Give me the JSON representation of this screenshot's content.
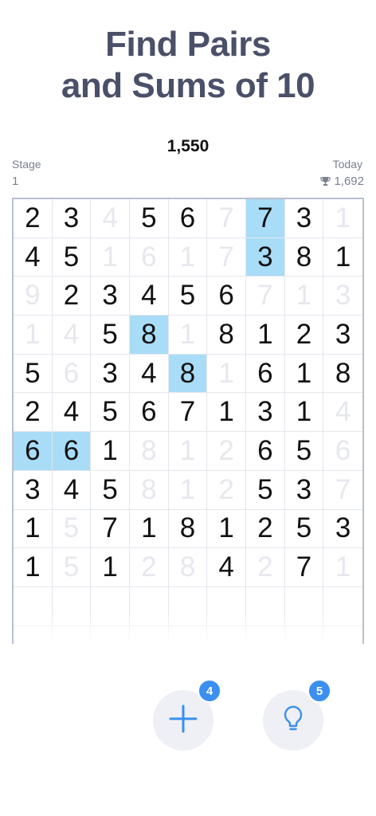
{
  "headline": {
    "line1": "Find Pairs",
    "line2": "and Sums of 10"
  },
  "score": "1,550",
  "stage": {
    "label": "Stage",
    "value": "1"
  },
  "today": {
    "label": "Today",
    "value": "1,692",
    "icon": "trophy-icon"
  },
  "board": {
    "rows": [
      [
        {
          "v": "2"
        },
        {
          "v": "3"
        },
        {
          "v": "4",
          "dim": true
        },
        {
          "v": "5"
        },
        {
          "v": "6"
        },
        {
          "v": "7",
          "dim": true
        },
        {
          "v": "7",
          "sel": true
        },
        {
          "v": "3"
        },
        {
          "v": "1",
          "dim": true
        }
      ],
      [
        {
          "v": "4"
        },
        {
          "v": "5"
        },
        {
          "v": "1",
          "dim": true
        },
        {
          "v": "6",
          "dim": true
        },
        {
          "v": "1",
          "dim": true
        },
        {
          "v": "7",
          "dim": true
        },
        {
          "v": "3",
          "sel": true
        },
        {
          "v": "8"
        },
        {
          "v": "1"
        }
      ],
      [
        {
          "v": "9",
          "dim": true
        },
        {
          "v": "2"
        },
        {
          "v": "3"
        },
        {
          "v": "4"
        },
        {
          "v": "5"
        },
        {
          "v": "6"
        },
        {
          "v": "7",
          "dim": true
        },
        {
          "v": "1",
          "dim": true
        },
        {
          "v": "3",
          "dim": true
        }
      ],
      [
        {
          "v": "1",
          "dim": true
        },
        {
          "v": "4",
          "dim": true
        },
        {
          "v": "5"
        },
        {
          "v": "8",
          "sel": true
        },
        {
          "v": "1",
          "dim": true
        },
        {
          "v": "8"
        },
        {
          "v": "1"
        },
        {
          "v": "2"
        },
        {
          "v": "3"
        }
      ],
      [
        {
          "v": "5"
        },
        {
          "v": "6",
          "dim": true
        },
        {
          "v": "3"
        },
        {
          "v": "4"
        },
        {
          "v": "8",
          "sel": true
        },
        {
          "v": "1",
          "dim": true
        },
        {
          "v": "6"
        },
        {
          "v": "1"
        },
        {
          "v": "8"
        }
      ],
      [
        {
          "v": "2"
        },
        {
          "v": "4"
        },
        {
          "v": "5"
        },
        {
          "v": "6"
        },
        {
          "v": "7"
        },
        {
          "v": "1"
        },
        {
          "v": "3"
        },
        {
          "v": "1"
        },
        {
          "v": "4",
          "dim": true
        }
      ],
      [
        {
          "v": "6",
          "sel": true
        },
        {
          "v": "6",
          "sel": true
        },
        {
          "v": "1"
        },
        {
          "v": "8",
          "dim": true
        },
        {
          "v": "1",
          "dim": true
        },
        {
          "v": "2",
          "dim": true
        },
        {
          "v": "6"
        },
        {
          "v": "5"
        },
        {
          "v": "6",
          "dim": true
        }
      ],
      [
        {
          "v": "3"
        },
        {
          "v": "4"
        },
        {
          "v": "5"
        },
        {
          "v": "8",
          "dim": true
        },
        {
          "v": "1",
          "dim": true
        },
        {
          "v": "2",
          "dim": true
        },
        {
          "v": "5"
        },
        {
          "v": "3"
        },
        {
          "v": "7",
          "dim": true
        }
      ],
      [
        {
          "v": "1"
        },
        {
          "v": "5",
          "dim": true
        },
        {
          "v": "7"
        },
        {
          "v": "1"
        },
        {
          "v": "8"
        },
        {
          "v": "1"
        },
        {
          "v": "2"
        },
        {
          "v": "5"
        },
        {
          "v": "3"
        }
      ],
      [
        {
          "v": "1"
        },
        {
          "v": "5",
          "dim": true
        },
        {
          "v": "1"
        },
        {
          "v": "2",
          "dim": true
        },
        {
          "v": "8",
          "dim": true
        },
        {
          "v": "4"
        },
        {
          "v": "2",
          "dim": true
        },
        {
          "v": "7"
        },
        {
          "v": "1",
          "dim": true
        }
      ],
      [
        {
          "v": ""
        },
        {
          "v": ""
        },
        {
          "v": ""
        },
        {
          "v": ""
        },
        {
          "v": ""
        },
        {
          "v": ""
        },
        {
          "v": ""
        },
        {
          "v": ""
        },
        {
          "v": ""
        }
      ],
      [
        {
          "v": ""
        },
        {
          "v": ""
        },
        {
          "v": ""
        },
        {
          "v": ""
        },
        {
          "v": ""
        },
        {
          "v": ""
        },
        {
          "v": ""
        },
        {
          "v": ""
        },
        {
          "v": ""
        }
      ]
    ]
  },
  "actions": {
    "add": {
      "icon": "plus-icon",
      "badge": "4"
    },
    "hint": {
      "icon": "lightbulb-icon",
      "badge": "5"
    }
  },
  "colors": {
    "selected": "#a9dcf7",
    "badge": "#3a8ff0",
    "icon": "#3a8ff0",
    "headline": "#4a5068"
  }
}
